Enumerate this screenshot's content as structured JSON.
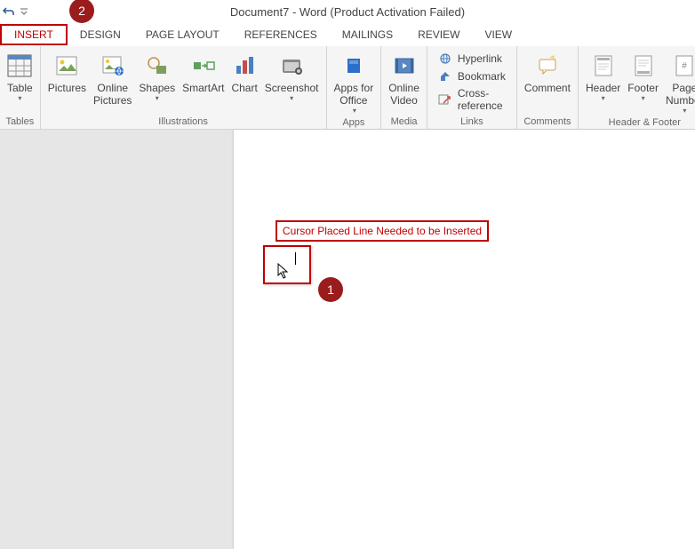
{
  "titlebar": {
    "title": "Document7 - Word (Product Activation Failed)"
  },
  "annotations": {
    "badge2": "2",
    "badge1": "1",
    "cursor_label": "Cursor Placed Line Needed to be Inserted"
  },
  "tabs": {
    "insert": "INSERT",
    "design": "DESIGN",
    "page_layout": "PAGE LAYOUT",
    "references": "REFERENCES",
    "mailings": "MAILINGS",
    "review": "REVIEW",
    "view": "VIEW"
  },
  "ribbon": {
    "tables": {
      "label": "Tables",
      "table": "Table"
    },
    "illustrations": {
      "label": "Illustrations",
      "pictures": "Pictures",
      "online_pictures": "Online\nPictures",
      "shapes": "Shapes",
      "smartart": "SmartArt",
      "chart": "Chart",
      "screenshot": "Screenshot"
    },
    "apps": {
      "label": "Apps",
      "apps_for_office": "Apps for\nOffice"
    },
    "media": {
      "label": "Media",
      "online_video": "Online\nVideo"
    },
    "links": {
      "label": "Links",
      "hyperlink": "Hyperlink",
      "bookmark": "Bookmark",
      "cross_reference": "Cross-reference"
    },
    "comments": {
      "label": "Comments",
      "comment": "Comment"
    },
    "header_footer": {
      "label": "Header & Footer",
      "header": "Header",
      "footer": "Footer",
      "page_number": "Page\nNumber"
    }
  }
}
